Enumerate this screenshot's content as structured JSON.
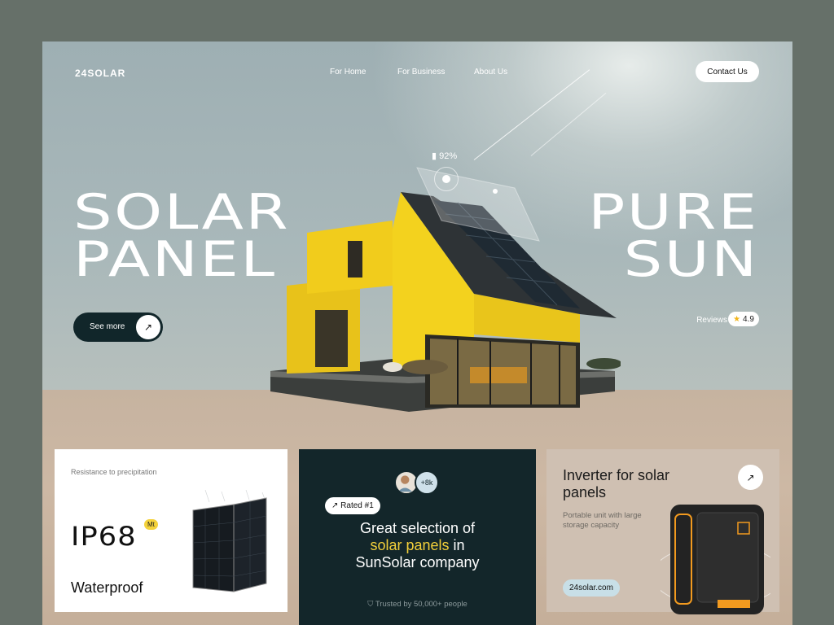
{
  "header": {
    "logo": "24SOLAR",
    "nav": [
      "For Home",
      "For Business",
      "About Us"
    ],
    "contact_label": "Contact Us"
  },
  "hero": {
    "left_line1": "SOLAR",
    "left_line2": "PANEL",
    "right_line1": "PURE",
    "right_line2": "SUN",
    "battery_percent": "92%",
    "see_more_label": "See more",
    "reviews_label": "Reviews",
    "rating": "4.9"
  },
  "cards": {
    "waterproof": {
      "caption": "Resistance to precipitation",
      "rating_code": "IP68",
      "badge": "Mt",
      "label": "Waterproof"
    },
    "selection": {
      "avatar_more": "+8k",
      "rated": "Rated #1",
      "title_line1": "Great selection of",
      "title_highlight": "solar panels",
      "title_after_highlight": " in",
      "title_line3": "SunSolar company",
      "trusted": "Trusted by 50,000+ people"
    },
    "inverter": {
      "title_line1": "Inverter for solar",
      "title_line2": "panels",
      "subtitle": "Portable unit with large storage capacity",
      "url": "24solar.com"
    }
  },
  "colors": {
    "dark": "#13262a",
    "accent_yellow": "#f2cf3a",
    "star": "#f2b51a"
  },
  "icons": {
    "arrow": "arrow-up-right-icon",
    "star": "star-icon",
    "battery": "battery-icon",
    "shield": "shield-icon"
  }
}
